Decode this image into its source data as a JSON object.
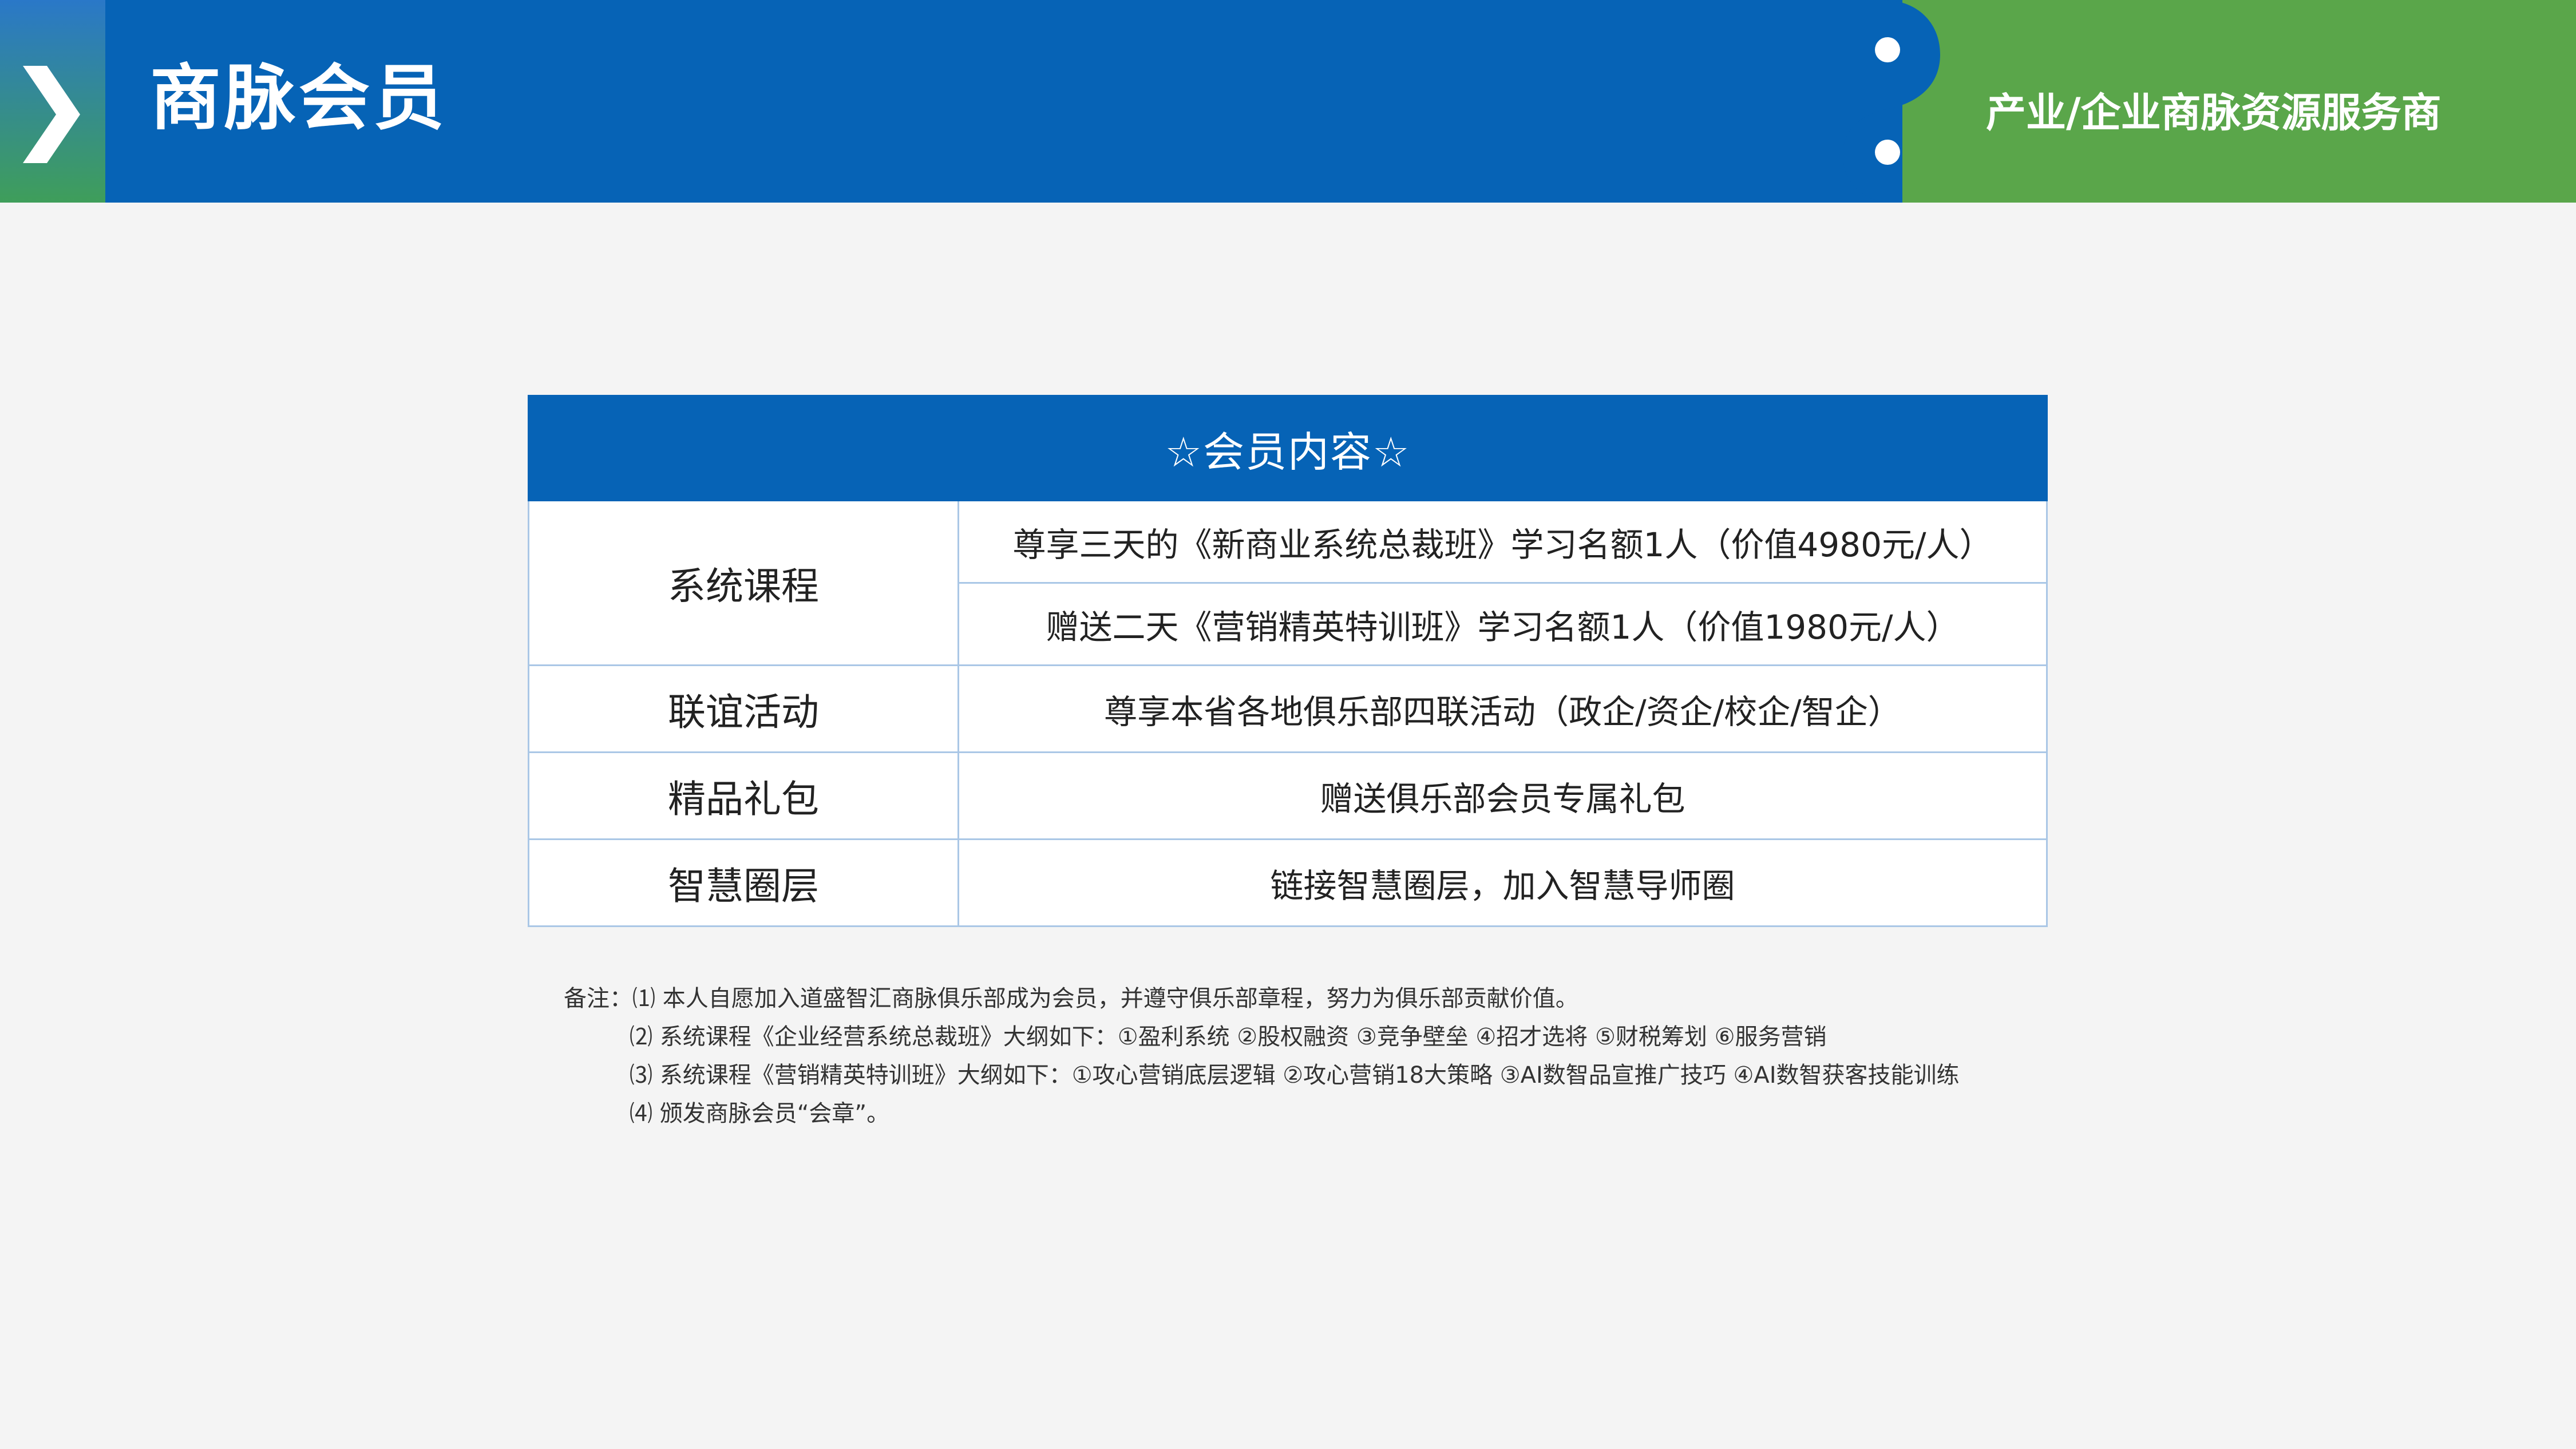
{
  "header": {
    "title": "商脉会员",
    "tagline": "产业/企业商脉资源服务商",
    "colors": {
      "primary_blue": "#0663b6",
      "accent_green": "#5aa64a"
    },
    "icons": [
      "chevron-right-icon"
    ]
  },
  "table": {
    "heading": "☆会员内容☆",
    "rows": [
      {
        "category": "系统课程",
        "items": [
          "尊享三天的《新商业系统总裁班》学习名额1人（价值4980元/人）",
          "赠送二天《营销精英特训班》学习名额1人（价值1980元/人）"
        ]
      },
      {
        "category": "联谊活动",
        "items": [
          "尊享本省各地俱乐部四联活动（政企/资企/校企/智企）"
        ]
      },
      {
        "category": "精品礼包",
        "items": [
          "赠送俱乐部会员专属礼包"
        ]
      },
      {
        "category": "智慧圈层",
        "items": [
          "链接智慧圈层，加入智慧导师圈"
        ]
      }
    ]
  },
  "notes": {
    "prefix": "备注：",
    "lines": [
      "⑴ 本人自愿加入道盛智汇商脉俱乐部成为会员，并遵守俱乐部章程，努力为俱乐部贡献价值。",
      "⑵ 系统课程《企业经营系统总裁班》大纲如下：①盈利系统  ②股权融资  ③竞争壁垒  ④招才选将  ⑤财税筹划  ⑥服务营销",
      "⑶ 系统课程《营销精英特训班》大纲如下：①攻心营销底层逻辑  ②攻心营销18大策略  ③AI数智品宣推广技巧  ④AI数智获客技能训练",
      "⑷ 颁发商脉会员“会章”。"
    ]
  }
}
